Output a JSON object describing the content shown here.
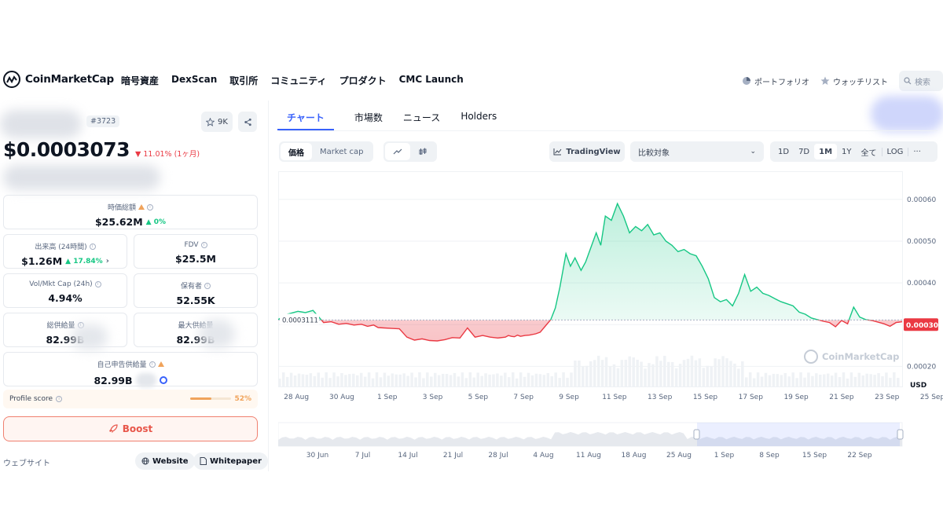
{
  "header": {
    "brand": "CoinMarketCap",
    "nav": [
      "暗号資産",
      "DexScan",
      "取引所",
      "コミュニティ",
      "プロダクト",
      "CMC Launch"
    ],
    "portfolio_label": "ポートフォリオ",
    "watchlist_label": "ウォッチリスト",
    "search_placeholder": "検索"
  },
  "coin": {
    "rank": "#3723",
    "watchers": "9K",
    "price": "$0.0003073",
    "change_1m": "11.01% (1ヶ月)"
  },
  "stats": {
    "market_cap_label": "時価総額",
    "market_cap": "$25.62M",
    "market_cap_change": "0%",
    "volume_label": "出来高 (24時間)",
    "volume": "$1.26M",
    "volume_change": "17.84%",
    "fdv_label": "FDV",
    "fdv": "$25.5M",
    "vol_mkt_label": "Vol/Mkt Cap (24h)",
    "vol_mkt": "4.94%",
    "holders_label": "保有者",
    "holders": "52.55K",
    "total_supply_label": "総供給量",
    "total_supply": "82.99B",
    "max_supply_label": "最大供給量",
    "max_supply": "82.99B",
    "self_reported_label": "自己申告供給量",
    "self_reported": "82.99B"
  },
  "profile": {
    "label": "Profile score",
    "value": "52%",
    "fraction": 0.52
  },
  "boost_label": "Boost",
  "website": {
    "label": "ウェブサイト",
    "website_btn": "Website",
    "whitepaper_btn": "Whitepaper"
  },
  "tabs": [
    "チャート",
    "市場数",
    "ニュース",
    "Holders"
  ],
  "controls": {
    "price_btn": "価格",
    "mcap_btn": "Market cap",
    "tradingview": "TradingView",
    "compare": "比較対象",
    "ranges": [
      "1D",
      "7D",
      "1M",
      "1Y",
      "全て",
      "LOG"
    ],
    "active_range": "1M",
    "more": "···"
  },
  "colors": {
    "up": "#16c784",
    "down": "#ea3943",
    "accent": "#3861fb"
  },
  "chart_data": {
    "type": "area",
    "baseline_label": "0.0003111",
    "baseline": 0.0003111,
    "last_label": "0.00030",
    "y_ticks": [
      "0.00060",
      "0.00050",
      "0.00040",
      "0.00030",
      "0.00020"
    ],
    "y_unit": "USD",
    "ylim": [
      0.00015,
      0.00066
    ],
    "x_ticks": [
      "28 Aug",
      "30 Aug",
      "1 Sep",
      "3 Sep",
      "5 Sep",
      "7 Sep",
      "9 Sep",
      "11 Sep",
      "13 Sep",
      "15 Sep",
      "17 Sep",
      "19 Sep",
      "21 Sep",
      "23 Sep",
      "25 Sep"
    ],
    "nav_ticks": [
      "30 Jun",
      "7 Jul",
      "14 Jul",
      "21 Jul",
      "28 Jul",
      "4 Aug",
      "11 Aug",
      "18 Aug",
      "25 Aug",
      "1 Sep",
      "8 Sep",
      "15 Sep",
      "22 Sep"
    ],
    "watermark": "CoinMarketCap",
    "series": [
      {
        "t": [
          0,
          0.5,
          1,
          1.3,
          1.8,
          2.3,
          3,
          3.5,
          4,
          4.5,
          5,
          5.5,
          5.9,
          6.3,
          6.6,
          7,
          7.5,
          8,
          8.5,
          9,
          9.5,
          10,
          10.5,
          11,
          11.5,
          12,
          12.5,
          13,
          13.5,
          14,
          14.5,
          15,
          15.2,
          15.4,
          15.6,
          15.8,
          16,
          16.3,
          16.6,
          17,
          17.3,
          17.6,
          18,
          18.3,
          18.6,
          19,
          19.3,
          19.6,
          20,
          20.3,
          20.6,
          21,
          21.3,
          21.6,
          22,
          22.4,
          22.8,
          23.2,
          23.6,
          24,
          24.4,
          24.8,
          25.2,
          25.6,
          26,
          26.4,
          26.8,
          27.2,
          27.6,
          28,
          28.4,
          28.8,
          29.2,
          29.6,
          30,
          30.4,
          30.8,
          31.2,
          31.6,
          32,
          32.4,
          32.8,
          33.2,
          33.6,
          34,
          34.4,
          34.8,
          35.2,
          35.6,
          36,
          36.4,
          36.8,
          37.2,
          37.6,
          38,
          38.4,
          38.8,
          39.2,
          39.6,
          40,
          40.4,
          40.8,
          41.2
        ],
        "y": [
          0.000312,
          0.000324,
          0.000329,
          0.000332,
          0.000329,
          0.000334,
          0.000305,
          0.000307,
          0.000301,
          0.000303,
          0.000299,
          0.000301,
          0.000296,
          0.000299,
          0.000293,
          0.000292,
          0.000291,
          0.00029,
          0.00027,
          0.000263,
          0.000266,
          0.000262,
          0.000261,
          0.000264,
          0.000269,
          0.000268,
          0.000292,
          0.00027,
          0.000274,
          0.00027,
          0.000268,
          0.00027,
          0.000274,
          0.000272,
          0.000271,
          0.000275,
          0.000272,
          0.000274,
          0.000275,
          0.000278,
          0.000282,
          0.000295,
          0.000312,
          0.00034,
          0.00039,
          0.00047,
          0.00044,
          0.00046,
          0.00043,
          0.00045,
          0.00048,
          0.00052,
          0.00049,
          0.00056,
          0.00055,
          0.00059,
          0.00056,
          0.00052,
          0.000535,
          0.000525,
          0.00054,
          0.000515,
          0.00052,
          0.0005,
          0.00049,
          0.000475,
          0.00048,
          0.00047,
          0.000465,
          0.00044,
          0.00041,
          0.000365,
          0.000355,
          0.00036,
          0.000345,
          0.000375,
          0.00042,
          0.00038,
          0.00039,
          0.000375,
          0.00037,
          0.000362,
          0.000355,
          0.00035,
          0.000345,
          0.00033,
          0.000325,
          0.000316,
          0.000312,
          0.000308,
          0.000305,
          0.000295,
          0.00031,
          0.000302,
          0.000342,
          0.000318,
          0.000312,
          0.00031,
          0.000306,
          0.000302,
          0.000296,
          0.000305,
          0.000307
        ]
      }
    ]
  }
}
